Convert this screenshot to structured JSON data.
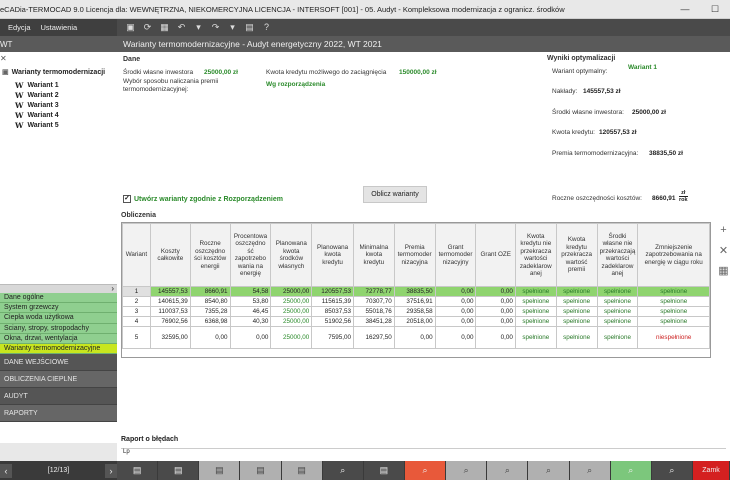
{
  "window": {
    "title": "eCADia-TERMOCAD 9.0 Licencja dla: WEWNĘTRZNA, NIEKOMERCYJNA LICENCJA - INTERSOFT [001] - 05. Audyt - Kompleksowa modernizacja z ogranicz. środków",
    "btn_min": "—",
    "btn_max": "☐",
    "btn_close": "✕"
  },
  "menu": {
    "edit": "Edycja",
    "settings": "Ustawienia"
  },
  "toolbar_icons": [
    "save-icon",
    "refresh-icon",
    "grid-icon",
    "undo-icon",
    "dropdown-icon",
    "redo-icon",
    "dropdown-icon",
    "calculator-icon",
    "help-icon"
  ],
  "left_header": "WT",
  "page_title": "Warianty termomodernizacyjne - Audyt energetyczny 2022, WT 2021",
  "tree": {
    "root": "Warianty termomodernizacji",
    "items": [
      {
        "icon": "W",
        "label": "Wariant 1"
      },
      {
        "icon": "W",
        "label": "Wariant 2"
      },
      {
        "icon": "W",
        "label": "Wariant 3"
      },
      {
        "icon": "W",
        "label": "Wariant 4"
      },
      {
        "icon": "W",
        "label": "Wariant 5"
      }
    ]
  },
  "nav": {
    "green_items": [
      "Dane ogólne",
      "System grzewczy",
      "Ciepła woda użytkowa",
      "Ściany, stropy, stropodachy",
      "Okna, drzwi, wentylacja",
      "Warianty termomodernizacyjne"
    ],
    "dark_items": [
      "DANE WEJŚCIOWE",
      "OBLICZENIA CIEPLNE",
      "AUDYT",
      "RAPORTY"
    ]
  },
  "pager": {
    "prev": "‹",
    "label": "[12/13]",
    "next": "›"
  },
  "dane": {
    "heading": "Dane",
    "srodki_label": "Środki własne inwestora",
    "srodki_value": "25000,00 zł",
    "wybor_label": "Wybór sposobu naliczania premii termomodernizacyjnej:",
    "kwota_label": "Kwota kredytu możliwego do zaciągnięcia",
    "kwota_value": "150000,00 zł",
    "wg_value": "Wg rozporządzenia",
    "checkbox_label": "Utwórz warianty zgodnie z Rozporządzeniem",
    "button_label": "Oblicz warianty"
  },
  "wyniki": {
    "heading": "Wyniki optymalizacji",
    "wariant_label": "Wariant optymalny:",
    "wariant_value": "Wariant 1",
    "naklady_label": "Nakłady:",
    "naklady_value": "145557,53 zł",
    "srodki_label": "Środki własne inwestora:",
    "srodki_value": "25000,00 zł",
    "kredyt_label": "Kwota kredytu:",
    "kredyt_value": "120557,53 zł",
    "premia_label": "Premia termomodernizacyjna:",
    "premia_value": "38835,50 zł",
    "roczne_label": "Roczne oszczędności kosztów:",
    "roczne_value": "8660,91",
    "roczne_unit_top": "zł",
    "roczne_unit_bottom": "rok"
  },
  "obliczenia": {
    "heading": "Obliczenia",
    "columns": [
      "Wariant",
      "Koszty całkowite",
      "Roczne oszczędności kosztów energii",
      "Procentowa oszczędność zapotrzebowania na energię",
      "Planowana kwota środków własnych",
      "Planowana kwota kredytu",
      "Minimalna kwota kredytu",
      "Premia termomodernizacyjna",
      "Grant termomodernizacyjny",
      "Grant OZE",
      "Kwota kredytu nie przekracza wartości zadeklarowanej",
      "Kwota kredytu przekracza wartość premii",
      "Środki własne nie przekraczają wartości zadeklarowanej",
      "Zmniejszenie zapotrzebowania na energię w ciągu roku"
    ],
    "column_display": [
      "Wariant",
      "Koszty całkowite",
      "Roczne oszczędno ści kosztów energii",
      "Procentowa oszczędno ść zapotrzebo wania na energię",
      "Planowana kwota środków własnych",
      "Planowana kwota kredytu",
      "Minimalna kwota kredytu",
      "Premia termomoder nizacyjna",
      "Grant termomoder nizacyjny",
      "Grant OZE",
      "Kwota kredytu nie przekracza wartości zadeklarow anej",
      "Kwota kredytu przekracza wartość premii",
      "Środki własne nie przekraczają wartości zadeklarow anej",
      "Zmniejszenie zapotrzebowania na energię w ciągu roku"
    ],
    "rows": [
      [
        "1",
        "145557,53",
        "8660,91",
        "54,58",
        "25000,00",
        "120557,53",
        "72778,77",
        "38835,50",
        "0,00",
        "0,00",
        "spełnione",
        "spełnione",
        "spełnione",
        "spełnione"
      ],
      [
        "2",
        "140615,39",
        "8540,80",
        "53,80",
        "25000,00",
        "115615,39",
        "70307,70",
        "37516,91",
        "0,00",
        "0,00",
        "spełnione",
        "spełnione",
        "spełnione",
        "spełnione"
      ],
      [
        "3",
        "110037,53",
        "7355,28",
        "46,45",
        "25000,00",
        "85037,53",
        "55018,76",
        "29358,58",
        "0,00",
        "0,00",
        "spełnione",
        "spełnione",
        "spełnione",
        "spełnione"
      ],
      [
        "4",
        "76902,56",
        "6368,98",
        "40,30",
        "25000,00",
        "51902,56",
        "38451,28",
        "20518,00",
        "0,00",
        "0,00",
        "spełnione",
        "spełnione",
        "spełnione",
        "spełnione"
      ],
      [
        "5",
        "32595,00",
        "0,00",
        "0,00",
        "25000,00",
        "7595,00",
        "16297,50",
        "0,00",
        "0,00",
        "0,00",
        "spełnione",
        "spełnione",
        "spełnione",
        "niespełnione"
      ]
    ]
  },
  "raport": {
    "heading": "Raport o błędach",
    "content": "Lp"
  },
  "bottom": {
    "last_label": "Zamk"
  }
}
